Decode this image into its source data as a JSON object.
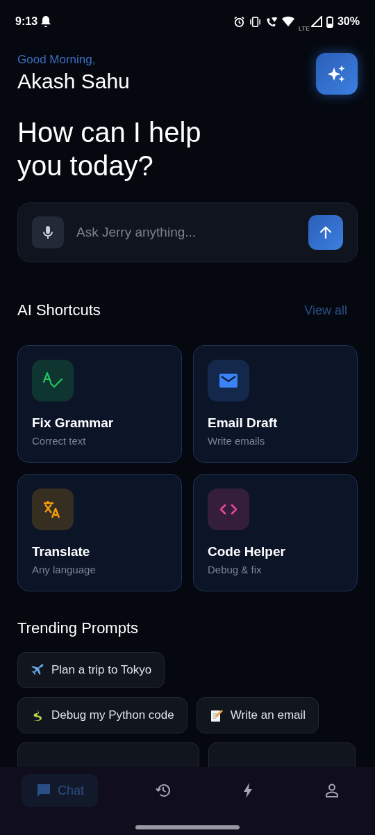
{
  "status_bar": {
    "time": "9:13",
    "network": "LTE",
    "battery": "30%"
  },
  "header": {
    "greeting": "Good Morning,",
    "name": "Akash Sahu"
  },
  "headline": "How can I help you today?",
  "input": {
    "placeholder": "Ask Jerry anything..."
  },
  "shortcuts": {
    "title": "AI Shortcuts",
    "view_all": "View all",
    "items": [
      {
        "kind": "grammar",
        "title": "Fix Grammar",
        "subtitle": "Correct text",
        "color": "#22c55e"
      },
      {
        "kind": "email",
        "title": "Email Draft",
        "subtitle": "Write emails",
        "color": "#3b82f6"
      },
      {
        "kind": "translate",
        "title": "Translate",
        "subtitle": "Any language",
        "color": "#f59e0b"
      },
      {
        "kind": "code",
        "title": "Code Helper",
        "subtitle": "Debug & fix",
        "color": "#ec4899"
      }
    ]
  },
  "trending": {
    "title": "Trending Prompts",
    "rows": [
      [
        {
          "kind": "plane",
          "label": "Plan a trip to Tokyo"
        }
      ],
      [
        {
          "kind": "snake",
          "label": "Debug my Python code"
        },
        {
          "kind": "memo",
          "label": "Write an email"
        }
      ]
    ]
  },
  "nav": [
    {
      "kind": "chat",
      "label": "Chat",
      "selected": true
    },
    {
      "kind": "history",
      "selected": false
    },
    {
      "kind": "bolt",
      "selected": false
    },
    {
      "kind": "profile",
      "selected": false
    }
  ]
}
